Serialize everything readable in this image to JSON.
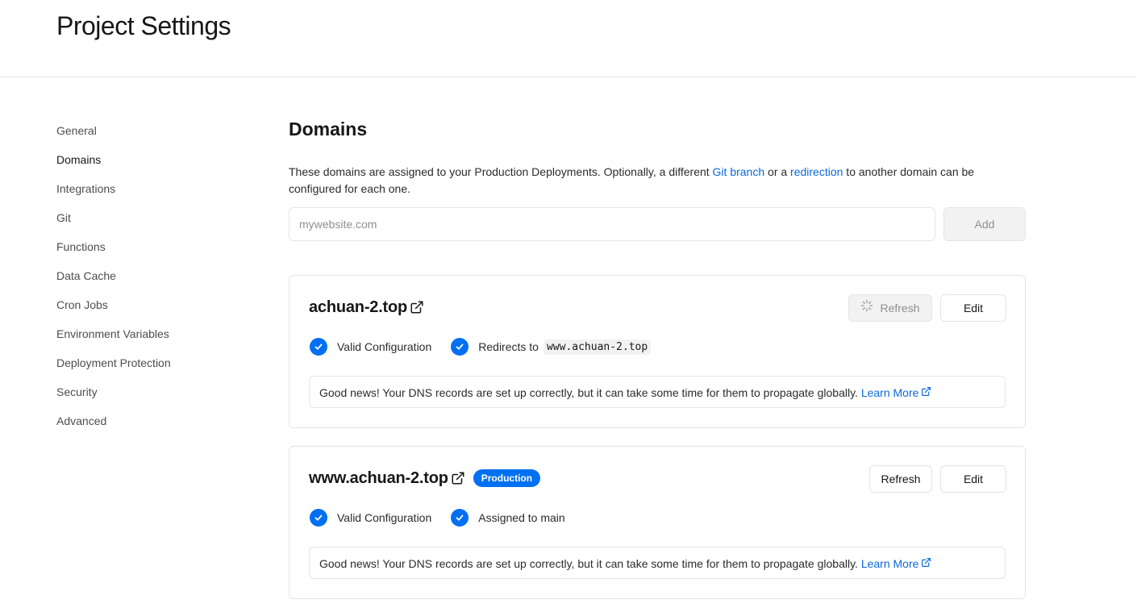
{
  "page": {
    "title": "Project Settings"
  },
  "sidebar": {
    "items": [
      {
        "label": "General"
      },
      {
        "label": "Domains",
        "active": true
      },
      {
        "label": "Integrations"
      },
      {
        "label": "Git"
      },
      {
        "label": "Functions"
      },
      {
        "label": "Data Cache"
      },
      {
        "label": "Cron Jobs"
      },
      {
        "label": "Environment Variables"
      },
      {
        "label": "Deployment Protection"
      },
      {
        "label": "Security"
      },
      {
        "label": "Advanced"
      }
    ]
  },
  "domains": {
    "title": "Domains",
    "description_part1": "These domains are assigned to your Production Deployments. Optionally, a different ",
    "link_git_branch": "Git branch",
    "description_part2": " or a ",
    "link_redirection": "redirection",
    "description_part3": " to another domain can be configured for each one.",
    "input_placeholder": "mywebsite.com",
    "input_value": "",
    "add_label": "Add",
    "cards": [
      {
        "domain": "achuan-2.top",
        "refresh_label": "Refresh",
        "refresh_loading": true,
        "edit_label": "Edit",
        "status1": "Valid Configuration",
        "status2_prefix": "Redirects to",
        "status2_code": "www.achuan-2.top",
        "notice": "Good news! Your DNS records are set up correctly, but it can take some time for them to propagate globally.",
        "learn_more": "Learn More"
      },
      {
        "domain": "www.achuan-2.top",
        "badge": "Production",
        "refresh_label": "Refresh",
        "edit_label": "Edit",
        "status1": "Valid Configuration",
        "status2": "Assigned to main",
        "notice": "Good news! Your DNS records are set up correctly, but it can take some time for them to propagate globally.",
        "learn_more": "Learn More"
      }
    ]
  },
  "colors": {
    "accent": "#0070f3",
    "link": "#0969da",
    "border": "#e5e5e5",
    "text": "#171717"
  }
}
